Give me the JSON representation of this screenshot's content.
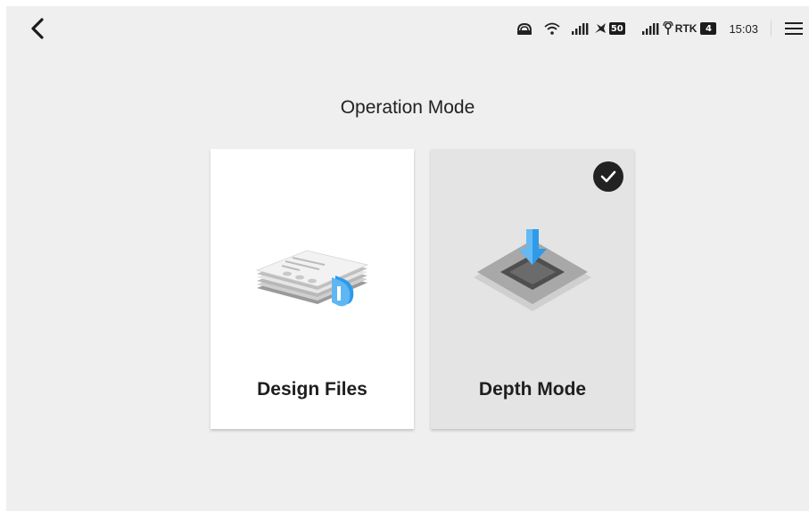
{
  "header": {
    "back_icon": "chevron-left-icon",
    "title": "Operation Mode"
  },
  "status_bar": {
    "icons": [
      "remote-controller-icon",
      "wifi-icon",
      "signal-bars-icon",
      "aircraft-icon",
      "signal-bars-icon",
      "rtk-antenna-icon"
    ],
    "aircraft_battery": "50",
    "rtk_label": "RTK",
    "rtk_count": "4",
    "time": "15:03",
    "menu_icon": "hamburger-menu-icon"
  },
  "cards": [
    {
      "label": "Design Files",
      "icon": "design-files-icon",
      "selected": false
    },
    {
      "label": "Depth Mode",
      "icon": "depth-mode-icon",
      "selected": true
    }
  ],
  "colors": {
    "background": "#efefef",
    "card_default": "#ffffff",
    "card_selected": "#e4e4e4",
    "accent_blue": "#2e9be9",
    "check_bg": "#222222"
  }
}
